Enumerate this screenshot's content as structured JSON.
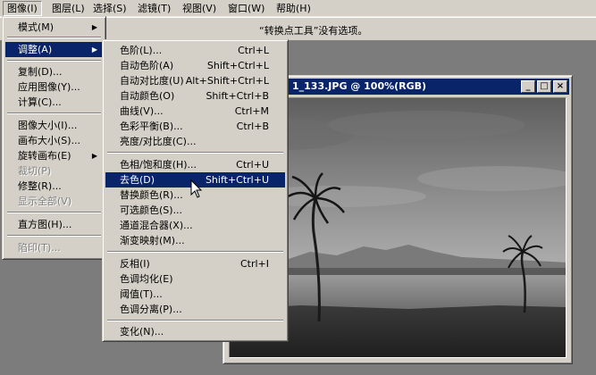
{
  "menubar": {
    "items": [
      {
        "label": "图像(I)"
      },
      {
        "label": "图层(L)"
      },
      {
        "label": "选择(S)"
      },
      {
        "label": "滤镜(T)"
      },
      {
        "label": "视图(V)"
      },
      {
        "label": "窗口(W)"
      },
      {
        "label": "帮助(H)"
      }
    ]
  },
  "options_bar": {
    "text": "“转换点工具”没有选项。"
  },
  "image_menu": {
    "items": [
      {
        "label": "模式(M)",
        "submenu": true
      },
      {
        "label": "调整(A)",
        "submenu": true,
        "highlighted": true
      },
      {
        "label": "复制(D)..."
      },
      {
        "label": "应用图像(Y)..."
      },
      {
        "label": "计算(C)..."
      },
      {
        "label": "图像大小(I)..."
      },
      {
        "label": "画布大小(S)..."
      },
      {
        "label": "旋转画布(E)",
        "submenu": true
      },
      {
        "label": "裁切(P)",
        "disabled": true
      },
      {
        "label": "修整(R)..."
      },
      {
        "label": "显示全部(V)",
        "disabled": true
      },
      {
        "label": "直方图(H)..."
      },
      {
        "label": "陷印(T)...",
        "disabled": true
      }
    ]
  },
  "adjust_menu": {
    "items": [
      {
        "label": "色阶(L)...",
        "shortcut": "Ctrl+L"
      },
      {
        "label": "自动色阶(A)",
        "shortcut": "Shift+Ctrl+L"
      },
      {
        "label": "自动对比度(U)",
        "shortcut": "Alt+Shift+Ctrl+L"
      },
      {
        "label": "自动颜色(O)",
        "shortcut": "Shift+Ctrl+B"
      },
      {
        "label": "曲线(V)...",
        "shortcut": "Ctrl+M"
      },
      {
        "label": "色彩平衡(B)...",
        "shortcut": "Ctrl+B"
      },
      {
        "label": "亮度/对比度(C)...",
        "shortcut": ""
      },
      {
        "label": "色相/饱和度(H)...",
        "shortcut": "Ctrl+U"
      },
      {
        "label": "去色(D)",
        "shortcut": "Shift+Ctrl+U",
        "highlighted": true
      },
      {
        "label": "替换颜色(R)...",
        "shortcut": ""
      },
      {
        "label": "可选颜色(S)...",
        "shortcut": ""
      },
      {
        "label": "通道混合器(X)...",
        "shortcut": ""
      },
      {
        "label": "渐变映射(M)...",
        "shortcut": ""
      },
      {
        "label": "反相(I)",
        "shortcut": "Ctrl+I"
      },
      {
        "label": "色调均化(E)",
        "shortcut": ""
      },
      {
        "label": "阈值(T)...",
        "shortcut": ""
      },
      {
        "label": "色调分离(P)...",
        "shortcut": ""
      },
      {
        "label": "变化(N)...",
        "shortcut": ""
      }
    ]
  },
  "document": {
    "title": "1_133.JPG @ 100%(RGB)",
    "buttons": {
      "minimize": "_",
      "maximize": "□",
      "close": "×"
    }
  },
  "icons": {
    "submenu_arrow": "triangle-right-icon",
    "cursor": "arrow-cursor-icon"
  },
  "colors": {
    "highlight": "#0a246a",
    "menu_bg": "#d4d0c8",
    "workspace": "#7c7c7c"
  }
}
